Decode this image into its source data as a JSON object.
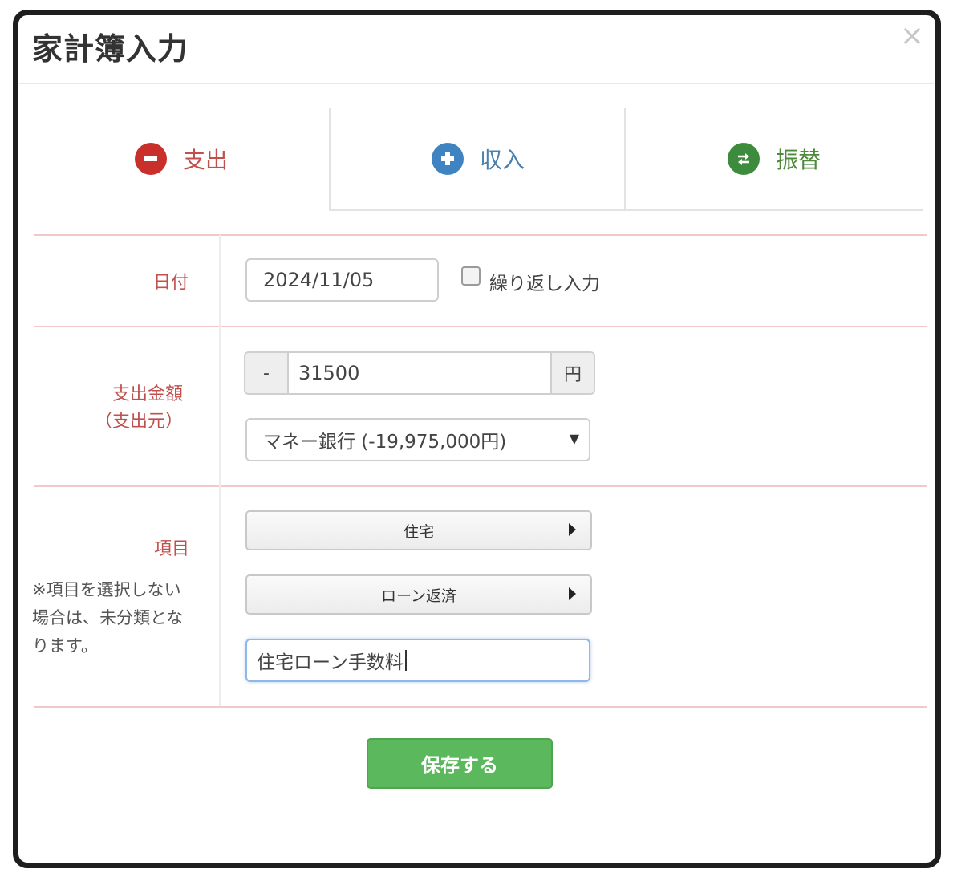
{
  "dialog": {
    "title": "家計簿入力",
    "close_symbol": "×"
  },
  "tabs": [
    {
      "label": "支出",
      "icon": "minus-circle-icon",
      "color": "#c0504d",
      "active": true
    },
    {
      "label": "収入",
      "icon": "plus-circle-icon",
      "color": "#4a7fae",
      "active": false
    },
    {
      "label": "振替",
      "icon": "transfer-circle-icon",
      "color": "#4f8a3c",
      "active": false
    }
  ],
  "date_row": {
    "label": "日付",
    "value": "2024/11/05",
    "repeat_label": "繰り返し入力",
    "repeat_checked": false
  },
  "amount_row": {
    "label_line1": "支出金額",
    "label_line2": "（支出元）",
    "sign": "-",
    "value": "31500",
    "unit": "円",
    "account_selected": "マネー銀行 (-19,975,000円)"
  },
  "category_row": {
    "label": "項目",
    "note": "※項目を選択しない場合は、未分類となります。",
    "category": "住宅",
    "subcategory": "ローン返済",
    "memo_value": "住宅ローン手数料"
  },
  "save_label": "保存する",
  "colors": {
    "accent_red": "#c0504d",
    "save_green": "#5cb85c"
  }
}
